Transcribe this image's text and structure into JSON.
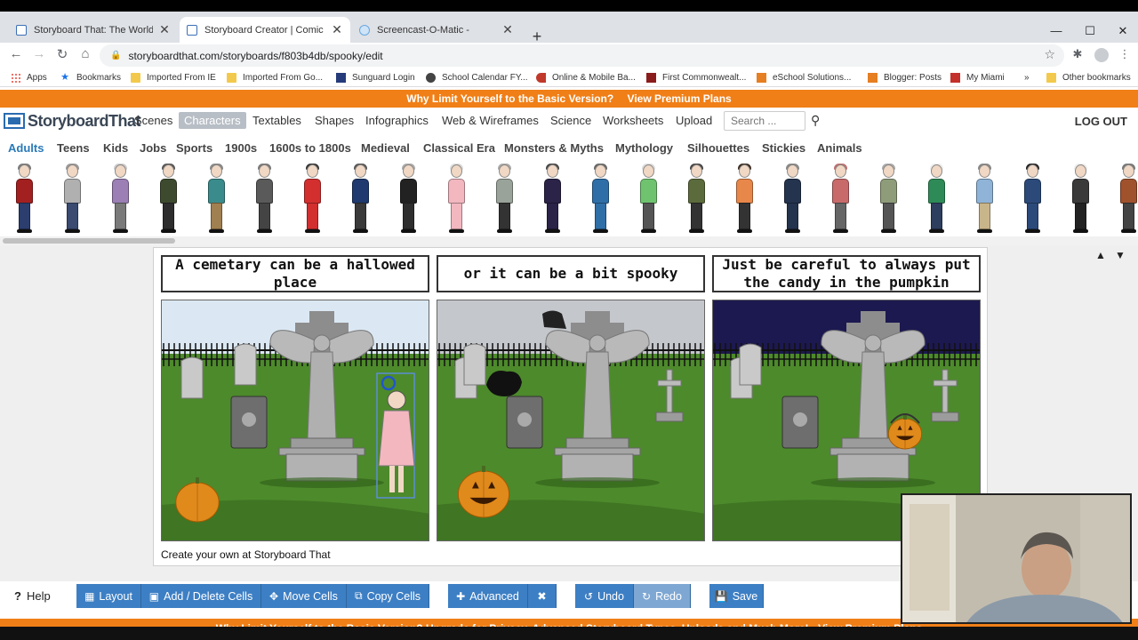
{
  "browser": {
    "tabs": [
      {
        "title": "Storyboard That: The World's Be",
        "active": false
      },
      {
        "title": "Storyboard Creator | Comic Strip",
        "active": true
      },
      {
        "title": "Screencast-O-Matic -",
        "active": false
      }
    ],
    "url": "storyboardthat.com/storyboards/f803b4db/spooky/edit",
    "bookmarks": [
      {
        "label": "Apps",
        "icon": "apps-grid-icon"
      },
      {
        "label": "Bookmarks",
        "icon": "star-icon"
      },
      {
        "label": "Imported From IE",
        "icon": "folder-icon"
      },
      {
        "label": "Imported From Go...",
        "icon": "folder-icon"
      },
      {
        "label": "Sunguard Login",
        "icon": "tac-icon"
      },
      {
        "label": "School Calendar FY...",
        "icon": "globe-icon"
      },
      {
        "label": "Online & Mobile Ba...",
        "icon": "key-icon"
      },
      {
        "label": "First Commonwealt...",
        "icon": "bank-icon"
      },
      {
        "label": "eSchool Solutions...",
        "icon": "esp-icon"
      },
      {
        "label": "Blogger: Posts",
        "icon": "blogger-icon"
      },
      {
        "label": "My Miami",
        "icon": "miami-icon"
      },
      {
        "label": "»",
        "icon": "overflow-icon"
      },
      {
        "label": "Other bookmarks",
        "icon": "folder-icon"
      }
    ]
  },
  "app": {
    "promo": {
      "text": "Why Limit Yourself to the Basic Version?",
      "link": "View Premium Plans"
    },
    "logo": "StoryboardThat",
    "nav": [
      {
        "label": "Scenes",
        "active": false
      },
      {
        "label": "Characters",
        "active": true
      },
      {
        "label": "Textables",
        "active": false
      },
      {
        "label": "Shapes",
        "active": false
      },
      {
        "label": "Infographics",
        "active": false
      },
      {
        "label": "Web & Wireframes",
        "active": false
      },
      {
        "label": "Science",
        "active": false
      },
      {
        "label": "Worksheets",
        "active": false
      },
      {
        "label": "Upload",
        "active": false
      }
    ],
    "search_placeholder": "Search ...",
    "logout": "LOG OUT",
    "categories": [
      {
        "label": "Adults",
        "active": true
      },
      {
        "label": "Teens",
        "active": false
      },
      {
        "label": "Kids",
        "active": false
      },
      {
        "label": "Jobs",
        "active": false
      },
      {
        "label": "Sports",
        "active": false
      },
      {
        "label": "1900s",
        "active": false
      },
      {
        "label": "1600s to 1800s",
        "active": false
      },
      {
        "label": "Medieval",
        "active": false
      },
      {
        "label": "Classical Era",
        "active": false
      },
      {
        "label": "Monsters & Myths",
        "active": false
      },
      {
        "label": "Mythology",
        "active": false
      },
      {
        "label": "Silhouettes",
        "active": false
      },
      {
        "label": "Stickies",
        "active": false
      },
      {
        "label": "Animals",
        "active": false
      }
    ],
    "characters": [
      {
        "top": "#a32020",
        "legs": "#2c3e6e",
        "hair": "#7a7a7a"
      },
      {
        "top": "#b0b0b0",
        "legs": "#3a4a70",
        "hair": "#9a9a9a"
      },
      {
        "top": "#9b7fb5",
        "legs": "#7a7a7a",
        "hair": "#ccc"
      },
      {
        "top": "#3d4a2e",
        "legs": "#2d2d2d",
        "hair": "#555"
      },
      {
        "top": "#3a8c8c",
        "legs": "#a08050",
        "hair": "#888"
      },
      {
        "top": "#5a5a5a",
        "legs": "#444",
        "hair": "#777"
      },
      {
        "top": "#d32f2f",
        "legs": "#d32f2f",
        "hair": "#333"
      },
      {
        "top": "#1e3a6e",
        "legs": "#3a3a3a",
        "hair": "#555"
      },
      {
        "top": "#222",
        "legs": "#2e2e2e",
        "hair": "#aaa"
      },
      {
        "top": "#f3b7c0",
        "legs": "#f3b7c0",
        "hair": "#ddd"
      },
      {
        "top": "#9aa39a",
        "legs": "#333",
        "hair": "#aaa"
      },
      {
        "top": "#2b2348",
        "legs": "#2b2348",
        "hair": "#444"
      },
      {
        "top": "#2f6fa8",
        "legs": "#2f6fa8",
        "hair": "#666"
      },
      {
        "top": "#6fc36f",
        "legs": "#555",
        "hair": "#ddd"
      },
      {
        "top": "#5c6b3c",
        "legs": "#333",
        "hair": "#444"
      },
      {
        "top": "#e8874a",
        "legs": "#333",
        "hair": "#3a2a20"
      },
      {
        "top": "#24344e",
        "legs": "#24344e",
        "hair": "#888"
      },
      {
        "top": "#c96a6a",
        "legs": "#666",
        "hair": "#c07070"
      },
      {
        "top": "#8e9c7a",
        "legs": "#555",
        "hair": "#aaa"
      },
      {
        "top": "#2e8b57",
        "legs": "#2e3e5e",
        "hair": "#eee"
      },
      {
        "top": "#8fb4d8",
        "legs": "#c9b58a",
        "hair": "#888"
      },
      {
        "top": "#2b4a7a",
        "legs": "#2b4a7a",
        "hair": "#222"
      },
      {
        "top": "#3a3a3a",
        "legs": "#222",
        "hair": "#eee"
      },
      {
        "top": "#a0522d",
        "legs": "#444",
        "hair": "#777"
      }
    ],
    "storyboard": {
      "cells": [
        {
          "caption": "A cemetary can be a hallowed place",
          "scene": "day"
        },
        {
          "caption": "or it can be a bit spooky",
          "scene": "overcast"
        },
        {
          "caption": "Just be careful to always put the candy in the pumpkin",
          "scene": "night"
        }
      ],
      "credit": "Create your own at Storyboard That",
      "colors": {
        "grass": "#4d8a2b",
        "day_sky": "#dbe8f3",
        "overcast_sky": "#c4c7cb",
        "night_sky": "#1c1950",
        "stone": "#a9a9a9",
        "pumpkin": "#e08a1c"
      }
    },
    "toolbar": [
      {
        "label": "Help",
        "icon": "help-icon"
      },
      {
        "label": "Layout",
        "icon": "layout-icon"
      },
      {
        "label": "Add / Delete Cells",
        "icon": "add-cells-icon"
      },
      {
        "label": "Move Cells",
        "icon": "move-icon"
      },
      {
        "label": "Copy Cells",
        "icon": "copy-icon"
      },
      {
        "label": "Advanced",
        "icon": "plus-icon"
      },
      {
        "label": "",
        "icon": "fullscreen-icon"
      },
      {
        "label": "Undo",
        "icon": "undo-icon"
      },
      {
        "label": "Redo",
        "icon": "redo-icon"
      },
      {
        "label": "Save",
        "icon": "save-icon"
      }
    ],
    "bottom_promo": "Why Limit Yourself to the Basic Version? Upgrade for Privacy, Advanced Storyboard Types, Uploads and Much More! - View Premium Plans"
  }
}
